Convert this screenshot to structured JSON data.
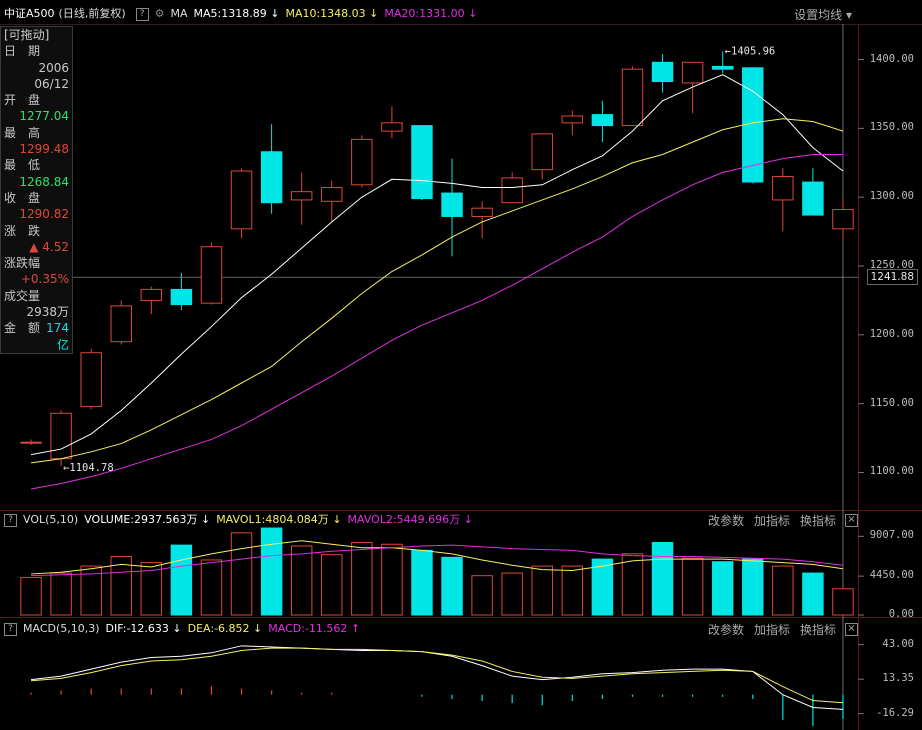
{
  "header": {
    "index_name": "中证A500",
    "period": "(日线,前复权)",
    "help": "?",
    "ma_label": "MA",
    "ma5": "MA5:1318.89",
    "ma10": "MA10:1348.03",
    "ma20": "MA20:1331.00",
    "settings": "设置均线"
  },
  "info": {
    "draggable": "[可拖动]",
    "date_label": "日　期",
    "date_year": "2006",
    "date_md": "06/12",
    "open_label": "开　盘",
    "open": "1277.04",
    "high_label": "最　高",
    "high": "1299.48",
    "low_label": "最　低",
    "low": "1268.84",
    "close_label": "收　盘",
    "close": "1290.82",
    "change_label": "涨　跌",
    "change": "▲ 4.52",
    "pct_label": "涨跌幅",
    "pct": "+0.35%",
    "vol_label": "成交量",
    "vol": "2938万",
    "amount_label": "金　额",
    "amount": "174亿"
  },
  "vol_panel": {
    "name": "VOL(5,10)",
    "volume": "VOLUME:2937.563万",
    "mavol1": "MAVOL1:4804.084万",
    "mavol2": "MAVOL2:5449.696万",
    "btn_params": "改参数",
    "btn_add": "加指标",
    "btn_switch": "换指标",
    "close": "×"
  },
  "macd_panel": {
    "name": "MACD(5,10,3)",
    "dif": "DIF:-12.633",
    "dea": "DEA:-6.852",
    "macd": "MACD:-11.562",
    "btn_params": "改参数",
    "btn_add": "加指标",
    "btn_switch": "换指标",
    "close": "×"
  },
  "colors": {
    "up": "#e0463a",
    "down": "#00e5e5",
    "ma5": "#ffffff",
    "ma10": "#f5f064",
    "ma20": "#e030e0",
    "grid": "#2a1010"
  },
  "chart_data": [
    {
      "type": "candlestick",
      "price_axis": {
        "ticks": [
          "1400.00",
          "1350.00",
          "1300.00",
          "1250.00",
          "1200.00",
          "1150.00",
          "1100.00"
        ],
        "range": [
          1080,
          1420
        ]
      },
      "crosshair_value": "1241.88",
      "max_label": "1405.96",
      "min_label": "1104.78",
      "candles": [
        {
          "o": 1122,
          "h": 1124,
          "l": 1120,
          "c": 1122
        },
        {
          "o": 1110,
          "h": 1145,
          "l": 1104.78,
          "c": 1143
        },
        {
          "o": 1148,
          "h": 1190,
          "l": 1146,
          "c": 1187
        },
        {
          "o": 1195,
          "h": 1225,
          "l": 1193,
          "c": 1221
        },
        {
          "o": 1225,
          "h": 1235,
          "l": 1215,
          "c": 1233
        },
        {
          "o": 1233,
          "h": 1245,
          "l": 1218,
          "c": 1222
        },
        {
          "o": 1223,
          "h": 1267,
          "l": 1222,
          "c": 1264
        },
        {
          "o": 1277,
          "h": 1321,
          "l": 1270,
          "c": 1319
        },
        {
          "o": 1333,
          "h": 1353,
          "l": 1288,
          "c": 1296
        },
        {
          "o": 1298,
          "h": 1318,
          "l": 1280,
          "c": 1304
        },
        {
          "o": 1297,
          "h": 1312,
          "l": 1282,
          "c": 1307
        },
        {
          "o": 1309,
          "h": 1345,
          "l": 1307,
          "c": 1342
        },
        {
          "o": 1348,
          "h": 1366,
          "l": 1343,
          "c": 1354
        },
        {
          "o": 1352,
          "h": 1352,
          "l": 1298,
          "c": 1299
        },
        {
          "o": 1303,
          "h": 1328,
          "l": 1257,
          "c": 1286
        },
        {
          "o": 1286,
          "h": 1297,
          "l": 1270,
          "c": 1292
        },
        {
          "o": 1296,
          "h": 1318,
          "l": 1296,
          "c": 1314
        },
        {
          "o": 1320,
          "h": 1346,
          "l": 1313,
          "c": 1346
        },
        {
          "o": 1354,
          "h": 1363,
          "l": 1345,
          "c": 1359
        },
        {
          "o": 1360,
          "h": 1370,
          "l": 1340,
          "c": 1352
        },
        {
          "o": 1352,
          "h": 1395,
          "l": 1352,
          "c": 1393
        },
        {
          "o": 1398,
          "h": 1404,
          "l": 1376,
          "c": 1384
        },
        {
          "o": 1383,
          "h": 1398,
          "l": 1361,
          "c": 1398
        },
        {
          "o": 1395,
          "h": 1405.96,
          "l": 1390,
          "c": 1393
        },
        {
          "o": 1394,
          "h": 1394,
          "l": 1310,
          "c": 1311
        },
        {
          "o": 1298,
          "h": 1321,
          "l": 1275,
          "c": 1315
        },
        {
          "o": 1311,
          "h": 1321,
          "l": 1287,
          "c": 1287
        },
        {
          "o": 1277,
          "h": 1299,
          "l": 1269,
          "c": 1291
        }
      ],
      "ma5": [
        1113,
        1117,
        1128,
        1145,
        1165,
        1186,
        1206,
        1227,
        1244,
        1263,
        1282,
        1300,
        1313,
        1312,
        1310,
        1307,
        1307,
        1309,
        1320,
        1330,
        1348,
        1370,
        1380,
        1389,
        1377,
        1360,
        1336,
        1319
      ],
      "ma10": [
        1107,
        1110,
        1115,
        1121,
        1131,
        1142,
        1153,
        1165,
        1177,
        1195,
        1212,
        1230,
        1246,
        1258,
        1271,
        1282,
        1290,
        1298,
        1306,
        1315,
        1325,
        1331,
        1340,
        1349,
        1354,
        1357,
        1355,
        1348
      ],
      "ma20": [
        1088,
        1092,
        1097,
        1103,
        1110,
        1117,
        1124,
        1134,
        1146,
        1158,
        1170,
        1183,
        1196,
        1207,
        1216,
        1225,
        1236,
        1248,
        1260,
        1271,
        1286,
        1298,
        1309,
        1318,
        1323,
        1328,
        1331,
        1331
      ]
    },
    {
      "type": "bar",
      "name": "VOL",
      "axis_ticks": [
        "9007.00",
        "4450.00",
        "0.00"
      ],
      "range": [
        0,
        9500
      ],
      "values": [
        4300,
        4800,
        5600,
        6700,
        6000,
        8000,
        6300,
        9400,
        10500,
        7900,
        6900,
        8300,
        8100,
        7400,
        6600,
        4500,
        4800,
        5600,
        5600,
        6400,
        7000,
        8300,
        6500,
        6100,
        6400,
        5600,
        4800,
        3000
      ],
      "mavol1": [
        4700,
        4900,
        5300,
        5800,
        5500,
        6300,
        7000,
        7600,
        8100,
        8500,
        8100,
        7700,
        7700,
        7400,
        7000,
        6300,
        5700,
        5200,
        5100,
        5600,
        6200,
        6400,
        6400,
        6400,
        6200,
        6000,
        5800,
        5300
      ],
      "mavol2": [
        4500,
        4600,
        4700,
        4900,
        5100,
        5600,
        6000,
        6400,
        6800,
        7000,
        7300,
        7500,
        7700,
        7900,
        8000,
        7800,
        7600,
        7500,
        7400,
        7000,
        6800,
        6700,
        6700,
        6600,
        6500,
        6400,
        6100,
        5700
      ]
    },
    {
      "type": "line",
      "name": "MACD",
      "axis_ticks": [
        "43.00",
        "13.35",
        "-16.29"
      ],
      "range": [
        -20,
        47
      ],
      "dif": [
        13,
        16,
        22,
        28,
        32,
        33,
        36,
        42,
        41,
        40,
        39,
        38,
        38,
        37,
        33,
        25,
        16,
        13,
        15,
        18,
        19,
        21,
        22,
        22,
        20,
        0,
        -11,
        -12.6
      ],
      "dea": [
        12,
        14,
        19,
        25,
        29,
        30,
        33,
        38,
        40,
        40,
        39,
        39,
        38,
        37,
        34,
        29,
        20,
        15,
        14,
        16,
        18,
        19,
        20,
        21,
        20,
        7,
        -5,
        -6.9
      ],
      "macd": [
        1,
        2,
        3,
        3,
        3,
        3,
        4,
        3,
        2,
        1,
        1,
        0,
        0,
        -1,
        -2,
        -3,
        -4,
        -5,
        -3,
        -2,
        -1,
        -1,
        -1,
        -1,
        -2,
        -12,
        -15,
        -11.6
      ]
    }
  ]
}
